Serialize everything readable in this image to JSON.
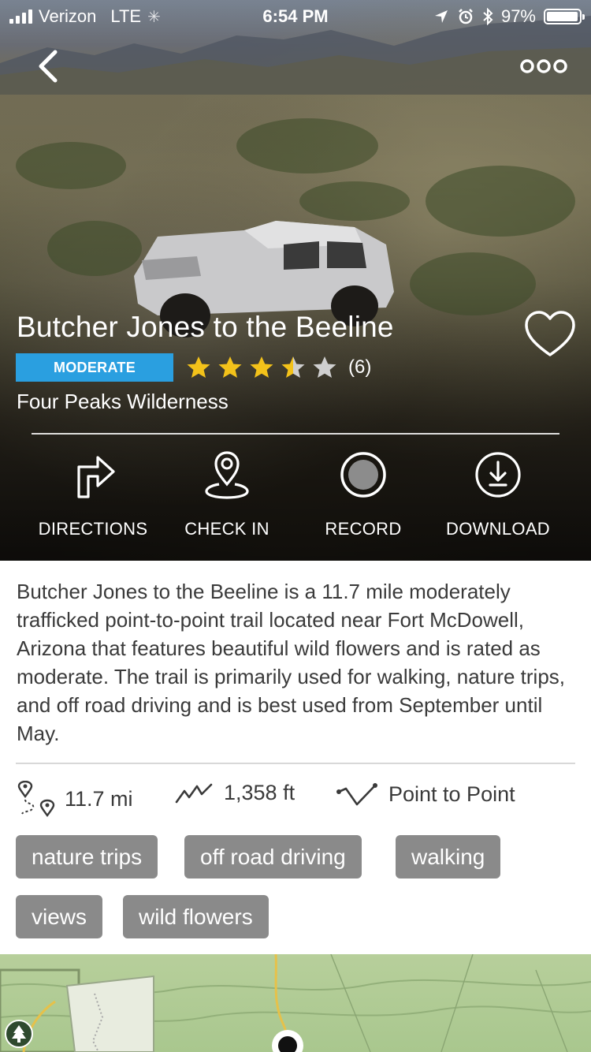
{
  "status_bar": {
    "carrier": "Verizon",
    "network": "LTE",
    "time": "6:54 PM",
    "battery": "97%",
    "battery_level": 0.97,
    "icons": [
      "signal-icon",
      "loading-icon",
      "location-arrow-icon",
      "alarm-icon",
      "bluetooth-icon",
      "battery-icon"
    ]
  },
  "nav": {
    "back_icon": "chevron-left-icon",
    "more_icon": "more-dots-icon"
  },
  "trail": {
    "title": "Butcher Jones to the Beeline",
    "difficulty": "MODERATE",
    "difficulty_color": "#2a9fe0",
    "rating": 3.5,
    "max_rating": 5,
    "review_count": "(6)",
    "area": "Four Peaks Wilderness",
    "favorite_icon": "heart-outline-icon"
  },
  "actions": [
    {
      "label": "DIRECTIONS",
      "icon": "directions-icon"
    },
    {
      "label": "CHECK IN",
      "icon": "check-in-pin-icon"
    },
    {
      "label": "RECORD",
      "icon": "record-icon"
    },
    {
      "label": "DOWNLOAD",
      "icon": "download-icon"
    }
  ],
  "description": "Butcher Jones to the Beeline is a 11.7 mile moderately trafficked point-to-point trail located near Fort McDowell, Arizona that features beautiful wild flowers and is rated as moderate. The trail is primarily used for walking, nature trips, and off road driving and is best used from September until May.",
  "stats": {
    "distance": "11.7 mi",
    "elevation": "1,358 ft",
    "route_type": "Point to Point"
  },
  "tags": [
    "nature trips",
    "off road driving",
    "walking",
    "views",
    "wild flowers"
  ],
  "colors": {
    "star": "#f3c21a",
    "star_empty": "#cfcfcf",
    "tag_bg": "#8a8a8a",
    "map_green": "#b7cf9b"
  }
}
